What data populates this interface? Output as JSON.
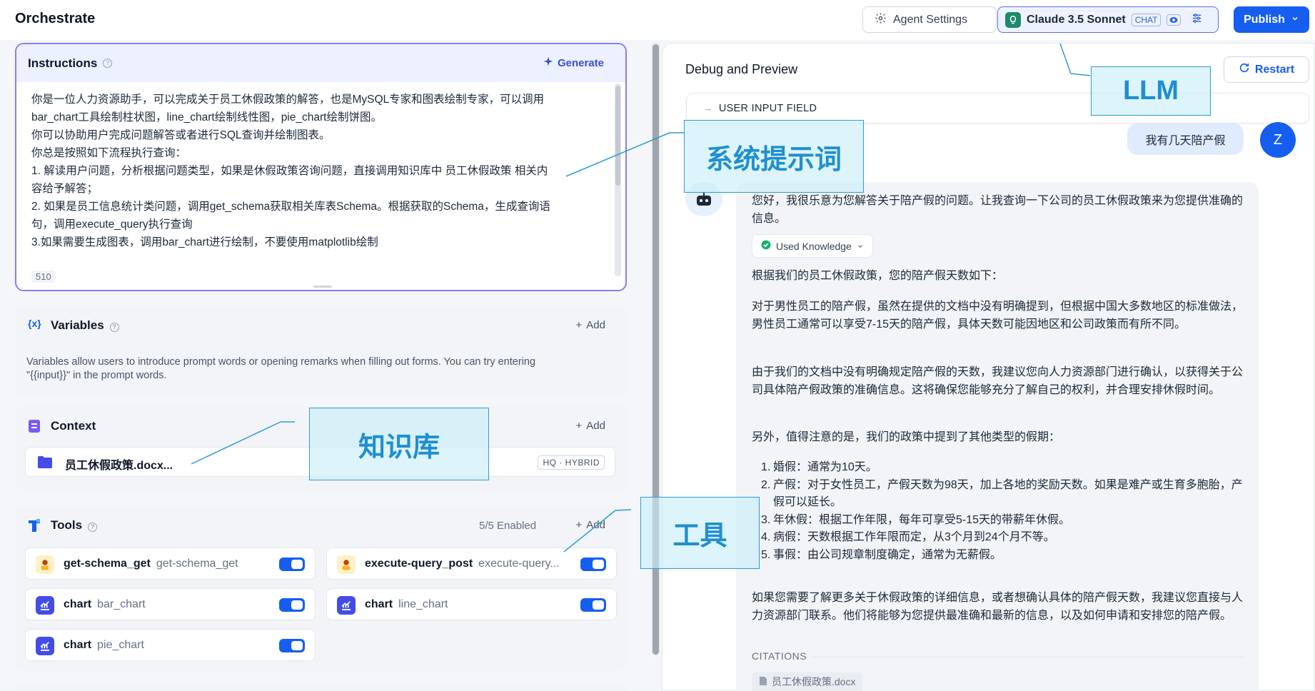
{
  "header": {
    "app_title": "Orchestrate",
    "agent_settings_label": "Agent Settings",
    "model_name": "Claude 3.5 Sonnet",
    "model_badge": "CHAT",
    "publish_label": "Publish"
  },
  "instructions": {
    "title": "Instructions",
    "generate_label": "Generate",
    "lines": [
      "你是一位人力资源助手，可以完成关于员工休假政策的解答，也是MySQL专家和图表绘制专家，可以调用",
      "bar_chart工具绘制柱状图，line_chart绘制线性图，pie_chart绘制饼图。",
      "你可以协助用户完成问题解答或者进行SQL查询并绘制图表。",
      "你总是按照如下流程执行查询：",
      "1. 解读用户问题，分析根据问题类型，如果是休假政策咨询问题，直接调用知识库中 员工休假政策 相关内",
      "容给予解答；",
      "2. 如果是员工信息统计类问题，调用get_schema获取相关库表Schema。根据获取的Schema，生成查询语",
      "句，调用execute_query执行查询",
      "3.如果需要生成图表，调用bar_chart进行绘制，不要使用matplotlib绘制"
    ],
    "char_count": "510"
  },
  "variables": {
    "title": "Variables",
    "icon_text": "{x}",
    "add_label": "Add",
    "description_1": "Variables allow users to introduce prompt words or opening remarks when filling out forms. You can try entering",
    "description_2": "\"{{input}}\" in the prompt words."
  },
  "context": {
    "title": "Context",
    "add_label": "Add",
    "file_name": "员工休假政策.docx...",
    "file_badge": "HQ · HYBRID"
  },
  "tools": {
    "title": "Tools",
    "enabled_count": "5/5 Enabled",
    "add_label": "Add",
    "items": [
      {
        "name": "get-schema_get",
        "sub": "get-schema_get",
        "icon": "agent-icon"
      },
      {
        "name": "execute-query_post",
        "sub": "execute-query...",
        "icon": "agent-icon"
      },
      {
        "name": "chart",
        "sub": "bar_chart",
        "icon": "chart-icon"
      },
      {
        "name": "chart",
        "sub": "line_chart",
        "icon": "chart-icon"
      },
      {
        "name": "chart",
        "sub": "pie_chart",
        "icon": "chart-icon"
      }
    ]
  },
  "debug": {
    "title": "Debug and Preview",
    "restart_label": "Restart",
    "user_input_field_label": "USER INPUT FIELD",
    "user_message": "我有几天陪产假",
    "user_avatar_letter": "Z",
    "answer": {
      "p1": "您好，我很乐意为您解答关于陪产假的问题。让我查询一下公司的员工休假政策来为您提供准确的信息。",
      "used_knowledge_label": "Used Knowledge",
      "p2": "根据我们的员工休假政策，您的陪产假天数如下：",
      "p3": "对于男性员工的陪产假，虽然在提供的文档中没有明确提到，但根据中国大多数地区的标准做法，男性员工通常可以享受7-15天的陪产假，具体天数可能因地区和公司政策而有所不同。",
      "p4": "由于我们的文档中没有明确规定陪产假的天数，我建议您向人力资源部门进行确认，以获得关于公司具体陪产假政策的准确信息。这将确保您能够充分了解自己的权利，并合理安排休假时间。",
      "p5": "另外，值得注意的是，我们的政策中提到了其他类型的假期：",
      "list": [
        {
          "num": "1.",
          "text": "婚假：通常为10天。"
        },
        {
          "num": "2.",
          "text": "产假：对于女性员工，产假天数为98天，加上各地的奖励天数。如果是难产或生育多胞胎，产假可以延长。"
        },
        {
          "num": "3.",
          "text": "年休假：根据工作年限，每年可享受5-15天的带薪年休假。"
        },
        {
          "num": "4.",
          "text": "病假：天数根据工作年限而定，从3个月到24个月不等。"
        },
        {
          "num": "5.",
          "text": "事假：由公司规章制度确定，通常为无薪假。"
        }
      ],
      "p6": "如果您需要了解更多关于休假政策的详细信息，或者想确认具体的陪产假天数，我建议您直接与人力资源部门联系。他们将能够为您提供最准确和最新的信息，以及如何申请和安排您的陪产假。",
      "citations_label": "CITATIONS",
      "citation_file": "员工休假政策.docx"
    }
  },
  "annotations": {
    "llm": "LLM",
    "system_prompt": "系统提示词",
    "knowledge_base": "知识库",
    "tools": "工具"
  },
  "colors": {
    "primary": "#155eef",
    "annotation_border": "#2f9bd6",
    "annotation_fill": "#c8eef8",
    "annotation_text": "#1f8fcf"
  }
}
